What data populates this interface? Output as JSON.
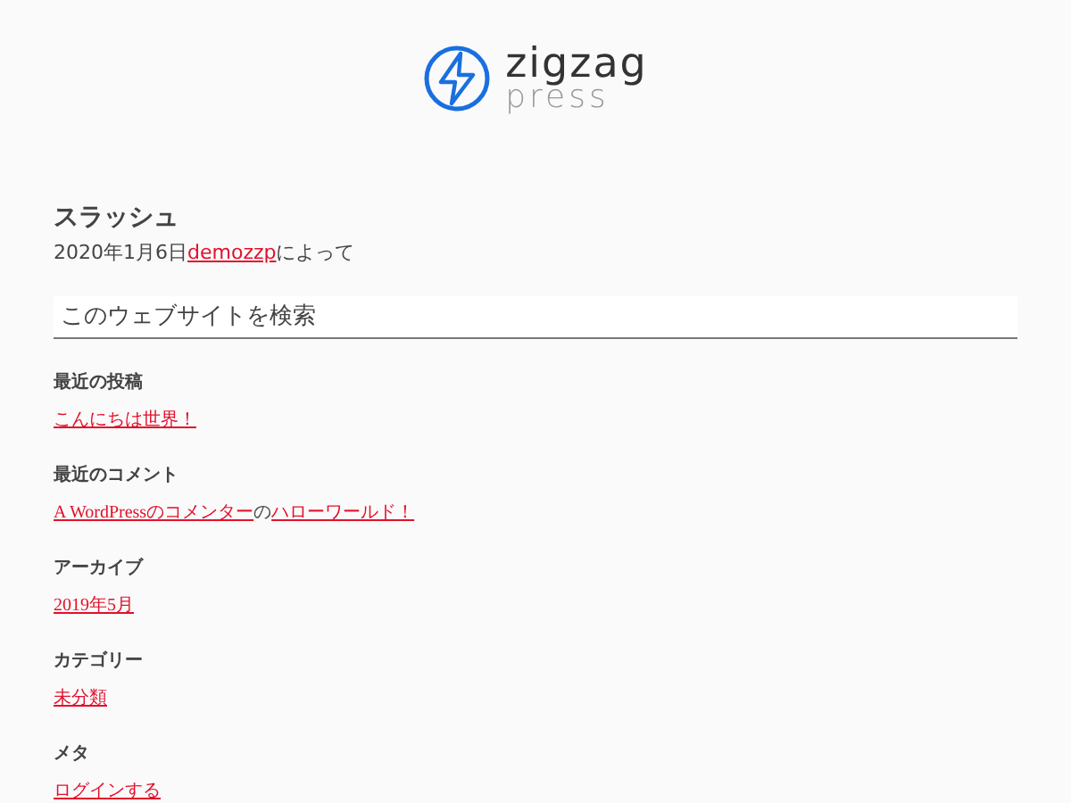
{
  "logo": {
    "name": "zigzag",
    "tagline": "press"
  },
  "post": {
    "title": "スラッシュ",
    "date": "2020年1月6日",
    "author": "demozzp",
    "byline_suffix": "によって"
  },
  "search": {
    "placeholder": "このウェブサイトを検索"
  },
  "widgets": [
    {
      "title": "最近の投稿",
      "parts": [
        {
          "kind": "link",
          "text": "こんにちは世界！"
        }
      ]
    },
    {
      "title": "最近のコメント",
      "parts": [
        {
          "kind": "link",
          "text": "A WordPressのコメンター"
        },
        {
          "kind": "plain",
          "text": "の"
        },
        {
          "kind": "link",
          "text": "ハローワールド！"
        }
      ]
    },
    {
      "title": "アーカイブ",
      "parts": [
        {
          "kind": "link",
          "text": "2019年5月"
        }
      ]
    },
    {
      "title": "カテゴリー",
      "parts": [
        {
          "kind": "link",
          "text": "未分類"
        }
      ]
    },
    {
      "title": "メタ",
      "parts": [
        {
          "kind": "link",
          "text": "ログインする"
        }
      ]
    }
  ]
}
